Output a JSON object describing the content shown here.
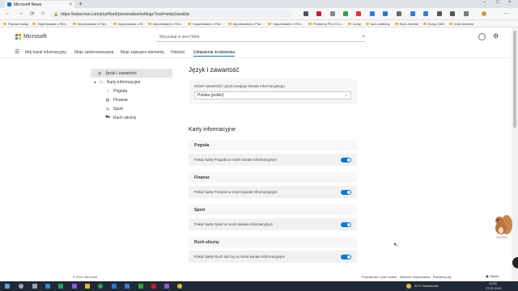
{
  "browser": {
    "tab_title": "Microsoft News",
    "url": "https://www.msn.com/pl-pl/feed/personalize/settings?ocid=winp1taskbar",
    "bookmarks": [
      "Parowa dodaj",
      "Importowane z Fire...",
      "Importowane z Fire...",
      "Importowane z IE",
      "Importowane z Fire...",
      "Importowane z Fire...",
      "Importowane z Fire...",
      "Importowane z Fire...",
      "Powermy Pro 2.0.1...",
      "kursy",
      "kurs ulubiony",
      "Kurs Joomla!",
      "Kursy CMS",
      "Inne ulubione"
    ]
  },
  "header": {
    "brand": "Microsoft",
    "search_placeholder": "Wyszukaj w sieci Web"
  },
  "subnav": {
    "items": [
      "Mój kanał informacyjny",
      "Moje zainteresowania",
      "Moje zapisane elementy",
      "Historia",
      "Ustawienia środowiska"
    ]
  },
  "sidebar": {
    "items": [
      {
        "label": "Język i zawartość",
        "icon": "globe-icon"
      },
      {
        "label": "Karty informacyjne",
        "icon": "cards-icon"
      },
      {
        "label": "Pogoda",
        "icon": "weather-icon"
      },
      {
        "label": "Finanse",
        "icon": "finance-icon"
      },
      {
        "label": "Sport",
        "icon": "sport-icon"
      },
      {
        "label": "Ruch uliczny",
        "icon": "traffic-icon"
      }
    ]
  },
  "language": {
    "heading": "Język i zawartość",
    "label": "Zmień zawartość i język swojego kanału informacyjnego",
    "selected": "Polska (polski)"
  },
  "cards_section": {
    "heading": "Karty informacyjne",
    "cards": [
      {
        "title": "Pogoda",
        "toggle_label": "Pokaż kartę Pogoda w moim kanale informacyjnym",
        "on": true
      },
      {
        "title": "Finanse",
        "toggle_label": "Pokaż kartę Finanse w moim kanale informacyjnym",
        "on": true
      },
      {
        "title": "Sport",
        "toggle_label": "Pokaż kartę Sport w moim kanale informacyjnym",
        "on": true
      },
      {
        "title": "Ruch uliczny",
        "toggle_label": "Pokaż kartę Ruch uliczny w moim kanale informacyjnym",
        "on": true
      }
    ]
  },
  "footer": {
    "copyright": "© 2021 Microsoft",
    "links": [
      "Prywatność i pliki cookie",
      "Warunki użytkowania",
      "Reklamuj się"
    ],
    "options": "Opinie"
  },
  "taskbar": {
    "weather": "24°C Słonecznie",
    "time": "11:00",
    "date": "27.07.2021"
  },
  "colors": {
    "accent": "#0078d4",
    "taskbar": "#202a36"
  }
}
